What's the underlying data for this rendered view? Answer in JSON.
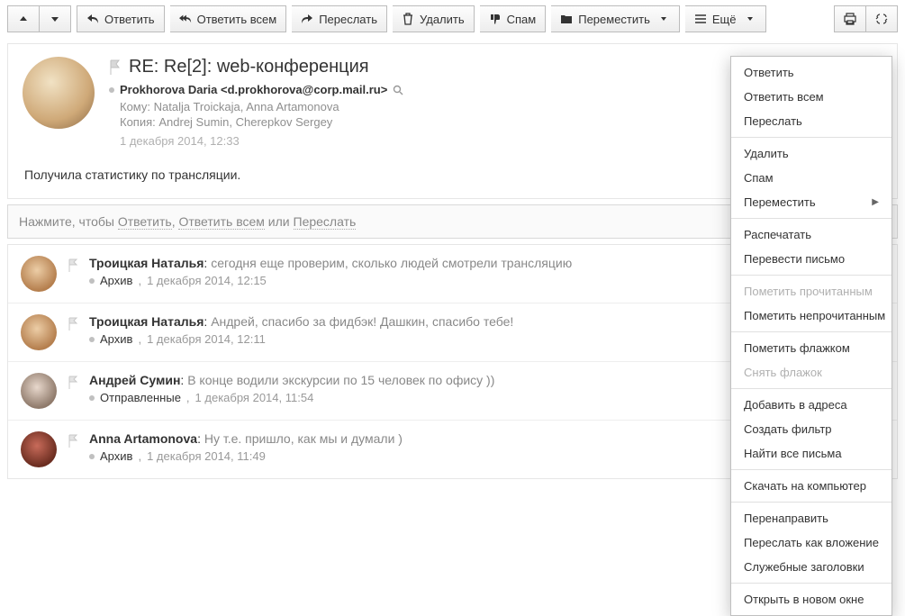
{
  "toolbar": {
    "reply": "Ответить",
    "reply_all": "Ответить всем",
    "forward": "Переслать",
    "delete": "Удалить",
    "spam": "Спам",
    "move": "Переместить",
    "more": "Ещё"
  },
  "message": {
    "subject": "RE: Re[2]: web-конференция",
    "from_label": "Prokhorova Daria <d.prokhorova@corp.mail.ru>",
    "to_label": "Кому: Natalja Troickaja, Anna Artamonova",
    "cc_label": "Копия: Andrej Sumin, Cherepkov Sergey",
    "date": "1 декабря 2014, 12:33",
    "body": "Получила статистику по трансляции."
  },
  "quick_reply": {
    "prefix": "Нажмите, чтобы ",
    "reply": "Ответить",
    "sep1": ", ",
    "reply_all": "Ответить всем",
    "sep2": " или ",
    "forward": "Переслать"
  },
  "thread": [
    {
      "sender": "Троицкая Наталья",
      "preview": "сегодня еще проверим, сколько людей смотрели трансляцию",
      "folder": "Архив",
      "date": "1 декабря 2014, 12:15",
      "avatar": "a1"
    },
    {
      "sender": "Троицкая Наталья",
      "preview": "Андрей, спасибо за фидбэк! Дашкин, спасибо тебе!",
      "folder": "Архив",
      "date": "1 декабря 2014, 12:11",
      "avatar": "a1"
    },
    {
      "sender": "Андрей Сумин",
      "preview": "В конце водили экскурсии по 15 человек по офису ))",
      "folder": "Отправленные",
      "date": "1 декабря 2014, 11:54",
      "avatar": "a3"
    },
    {
      "sender": "Anna Artamonova",
      "preview": "Ну т.е. пришло, как мы и думали )",
      "folder": "Архив",
      "date": "1 декабря 2014, 11:49",
      "avatar": "a4"
    }
  ],
  "dropdown": {
    "groups": [
      [
        {
          "label": "Ответить",
          "enabled": true,
          "submenu": false
        },
        {
          "label": "Ответить всем",
          "enabled": true,
          "submenu": false
        },
        {
          "label": "Переслать",
          "enabled": true,
          "submenu": false
        }
      ],
      [
        {
          "label": "Удалить",
          "enabled": true,
          "submenu": false
        },
        {
          "label": "Спам",
          "enabled": true,
          "submenu": false
        },
        {
          "label": "Переместить",
          "enabled": true,
          "submenu": true
        }
      ],
      [
        {
          "label": "Распечатать",
          "enabled": true,
          "submenu": false
        },
        {
          "label": "Перевести письмо",
          "enabled": true,
          "submenu": false
        }
      ],
      [
        {
          "label": "Пометить прочитанным",
          "enabled": false,
          "submenu": false
        },
        {
          "label": "Пометить непрочитанным",
          "enabled": true,
          "submenu": false
        }
      ],
      [
        {
          "label": "Пометить флажком",
          "enabled": true,
          "submenu": false
        },
        {
          "label": "Снять флажок",
          "enabled": false,
          "submenu": false
        }
      ],
      [
        {
          "label": "Добавить в адреса",
          "enabled": true,
          "submenu": false
        },
        {
          "label": "Создать фильтр",
          "enabled": true,
          "submenu": false
        },
        {
          "label": "Найти все письма",
          "enabled": true,
          "submenu": false
        }
      ],
      [
        {
          "label": "Скачать на компьютер",
          "enabled": true,
          "submenu": false
        }
      ],
      [
        {
          "label": "Перенаправить",
          "enabled": true,
          "submenu": false
        },
        {
          "label": "Переслать как вложение",
          "enabled": true,
          "submenu": false
        },
        {
          "label": "Служебные заголовки",
          "enabled": true,
          "submenu": false
        }
      ],
      [
        {
          "label": "Открыть в новом окне",
          "enabled": true,
          "submenu": false
        }
      ]
    ]
  }
}
